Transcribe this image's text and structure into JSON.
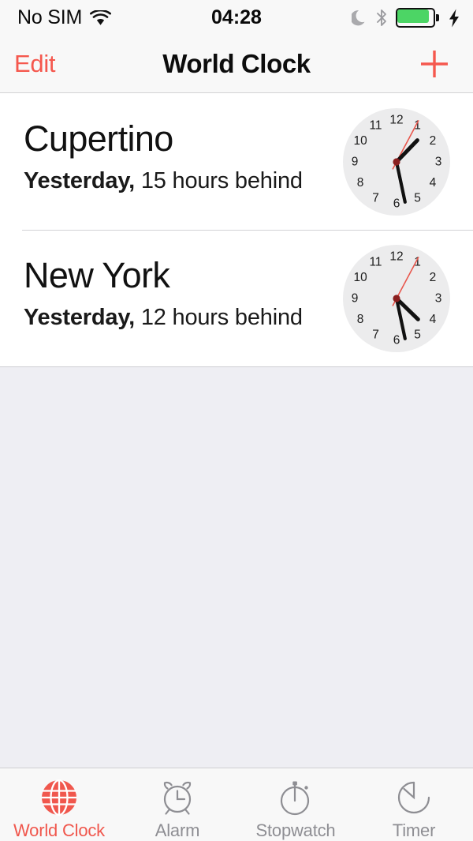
{
  "status_bar": {
    "carrier": "No SIM",
    "time": "04:28",
    "icons": [
      "wifi-icon",
      "moon-icon",
      "bluetooth-icon",
      "battery-icon",
      "charging-bolt-icon"
    ],
    "battery_level_percent": 86,
    "battery_color": "#4cd565"
  },
  "nav_bar": {
    "edit_label": "Edit",
    "title": "World Clock",
    "add_label": "+",
    "accent_color": "#f5584e"
  },
  "cities": [
    {
      "name": "Cupertino",
      "day_label": "Yesterday,",
      "offset_label": "15 hours behind",
      "clock": {
        "hour_angle": 44,
        "minute_angle": 168,
        "second_angle": 28
      }
    },
    {
      "name": "New York",
      "day_label": "Yesterday,",
      "offset_label": "12 hours behind",
      "clock": {
        "hour_angle": 134,
        "minute_angle": 168,
        "second_angle": 28
      }
    }
  ],
  "clock_face": {
    "numerals": [
      "12",
      "1",
      "2",
      "3",
      "4",
      "5",
      "6",
      "7",
      "8",
      "9",
      "10",
      "11"
    ],
    "face_color": "#ececed",
    "hand_color": "#111111",
    "second_hand_color": "#e8564c",
    "hub_color": "#8a1f1f"
  },
  "tab_bar": {
    "active_index": 0,
    "active_color": "#f0574d",
    "inactive_color": "#8e8e93",
    "tabs": [
      {
        "label": "World Clock",
        "icon": "globe-icon"
      },
      {
        "label": "Alarm",
        "icon": "alarm-clock-icon"
      },
      {
        "label": "Stopwatch",
        "icon": "stopwatch-icon"
      },
      {
        "label": "Timer",
        "icon": "timer-icon"
      }
    ]
  },
  "background_color": "#eeeef3"
}
